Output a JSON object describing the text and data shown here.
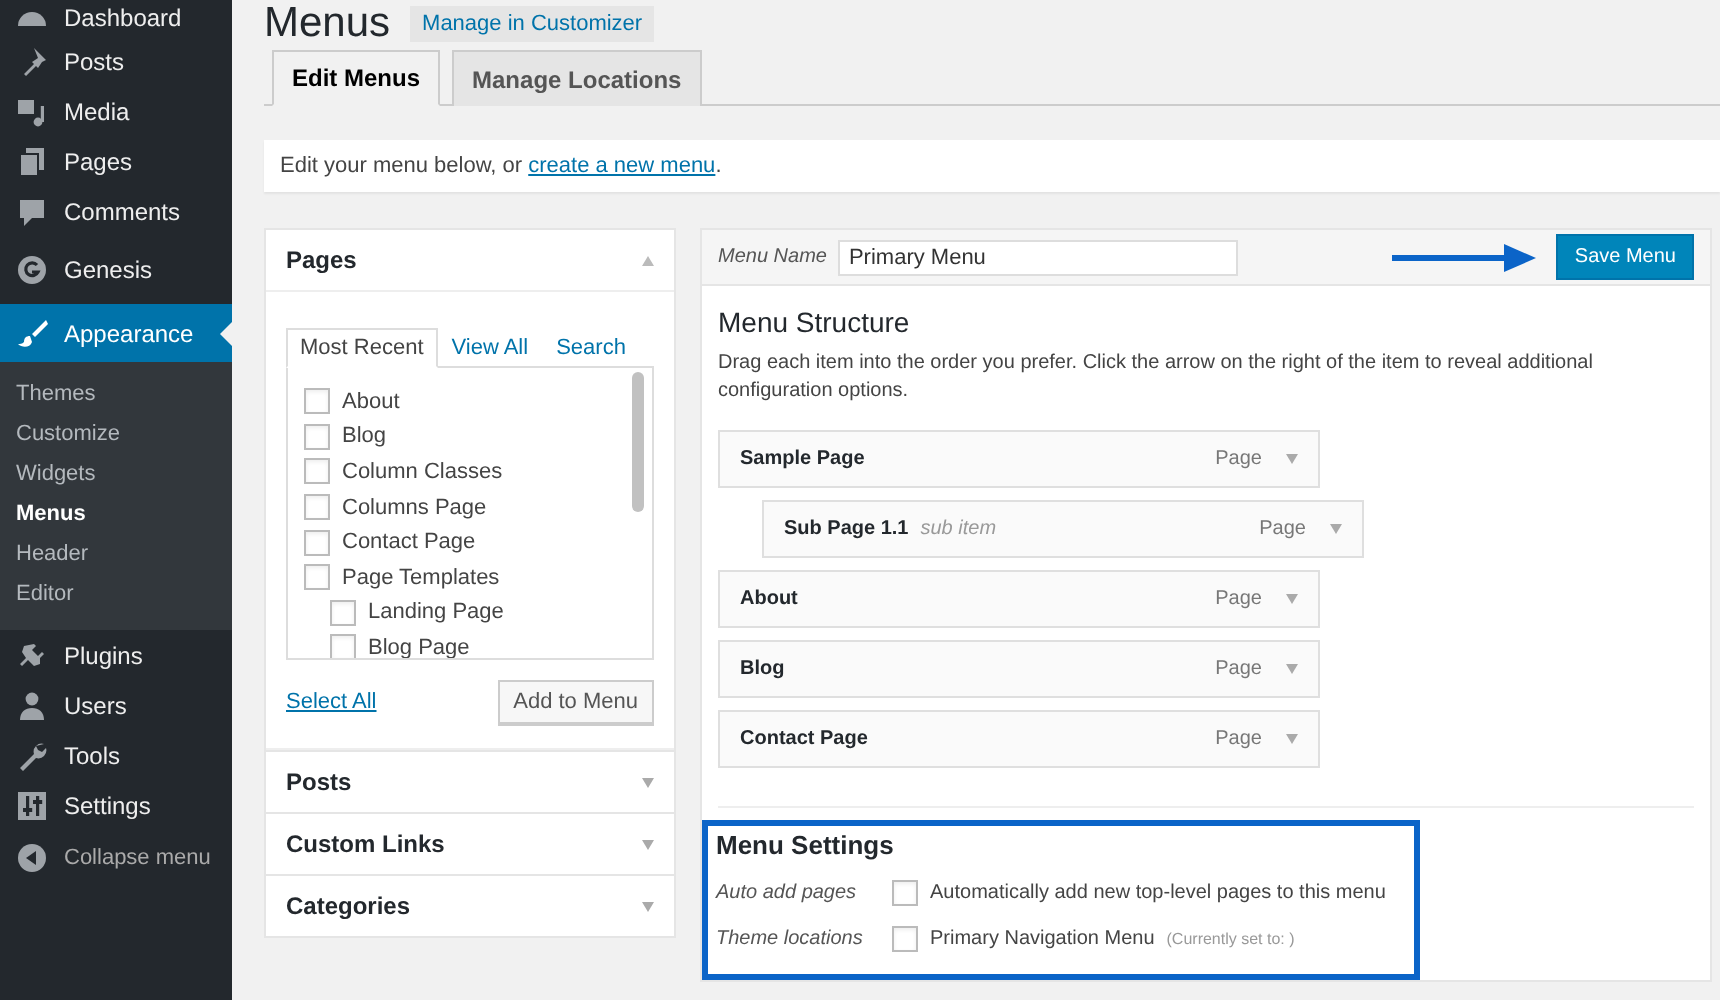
{
  "sidebar": {
    "groups": [
      [
        {
          "label": "Dashboard",
          "selected": false
        },
        {
          "label": "Posts",
          "selected": false
        },
        {
          "label": "Media",
          "selected": false
        },
        {
          "label": "Pages",
          "selected": false
        },
        {
          "label": "Comments",
          "selected": false
        }
      ],
      [
        {
          "label": "Genesis",
          "selected": false
        }
      ],
      [
        {
          "label": "Appearance",
          "selected": true,
          "children": [
            {
              "label": "Themes",
              "selected": false
            },
            {
              "label": "Customize",
              "selected": false
            },
            {
              "label": "Widgets",
              "selected": false
            },
            {
              "label": "Menus",
              "selected": true
            },
            {
              "label": "Header",
              "selected": false
            },
            {
              "label": "Editor",
              "selected": false
            }
          ]
        },
        {
          "label": "Plugins",
          "selected": false
        },
        {
          "label": "Users",
          "selected": false
        },
        {
          "label": "Tools",
          "selected": false
        },
        {
          "label": "Settings",
          "selected": false
        }
      ]
    ],
    "collapse_label": "Collapse menu"
  },
  "page": {
    "title": "Menus",
    "title_action": "Manage in Customizer"
  },
  "tabs": [
    {
      "label": "Edit Menus",
      "selected": true
    },
    {
      "label": "Manage Locations",
      "selected": false
    }
  ],
  "intro": {
    "text": "Edit your menu below, or ",
    "link": "create a new menu",
    "end": "."
  },
  "add_items": {
    "sections": [
      {
        "title": "Pages",
        "expanded": true,
        "tabs": [
          {
            "label": "Most Recent",
            "selected": true
          },
          {
            "label": "View All",
            "selected": false
          },
          {
            "label": "Search",
            "selected": false
          }
        ],
        "items": [
          {
            "label": "About",
            "checked": false
          },
          {
            "label": "Blog",
            "checked": false
          },
          {
            "label": "Column Classes",
            "checked": false
          },
          {
            "label": "Columns Page",
            "checked": false
          },
          {
            "label": "Contact Page",
            "checked": false
          },
          {
            "label": "Page Templates",
            "checked": false,
            "children": [
              {
                "label": "Landing Page",
                "checked": false
              },
              {
                "label": "Blog Page",
                "checked": false
              }
            ]
          }
        ],
        "select_all": "Select All",
        "add_button": "Add to Menu"
      },
      {
        "title": "Posts",
        "expanded": false
      },
      {
        "title": "Custom Links",
        "expanded": false
      },
      {
        "title": "Categories",
        "expanded": false
      }
    ]
  },
  "menu_editor": {
    "name_label": "Menu Name",
    "name_value": "Primary Menu",
    "save_button": "Save Menu",
    "structure_title": "Menu Structure",
    "structure_help": "Drag each item into the order you prefer. Click the arrow on the right of the item to reveal additional configuration options.",
    "items": [
      {
        "title": "Sample Page",
        "type": "Page",
        "children": [
          {
            "title": "Sub Page 1.1",
            "note": "sub item",
            "type": "Page"
          }
        ]
      },
      {
        "title": "About",
        "type": "Page"
      },
      {
        "title": "Blog",
        "type": "Page"
      },
      {
        "title": "Contact Page",
        "type": "Page"
      }
    ],
    "settings_title": "Menu Settings",
    "settings": [
      {
        "label": "Auto add pages",
        "text": "Automatically add new top-level pages to this menu",
        "checked": false
      },
      {
        "label": "Theme locations",
        "text": "Primary Navigation Menu",
        "note": "(Currently set to: )",
        "checked": false
      }
    ]
  }
}
